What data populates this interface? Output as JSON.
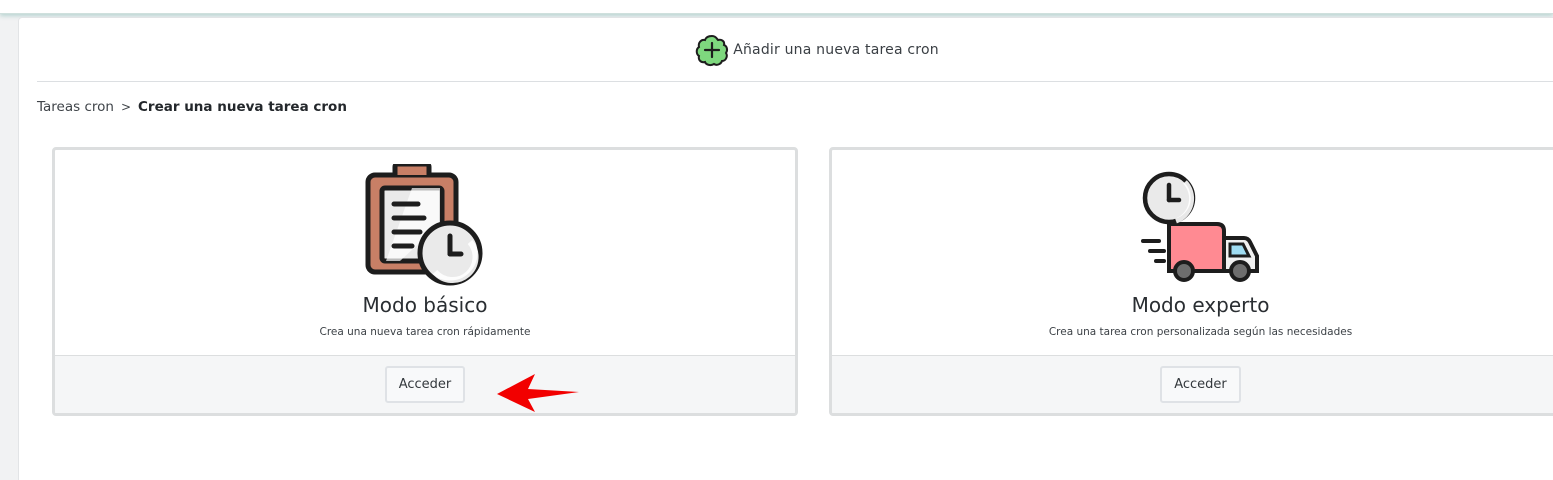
{
  "header": {
    "title": "Añadir una nueva tarea cron"
  },
  "breadcrumb": {
    "parent": "Tareas cron",
    "separator": ">",
    "current": "Crear una nueva tarea cron"
  },
  "cards": {
    "basic": {
      "title": "Modo básico",
      "description": "Crea una nueva tarea cron rápidamente",
      "button": "Acceder",
      "icon": "clipboard-clock-icon"
    },
    "expert": {
      "title": "Modo experto",
      "description": "Crea una tarea cron personalizada según las necesidades",
      "button": "Acceder",
      "icon": "delivery-truck-clock-icon"
    }
  },
  "colors": {
    "accent_green": "#7ed87e",
    "annotation_arrow": "#f20000",
    "clipboard_brown": "#c87f66",
    "truck_pink": "#ff8a92"
  }
}
